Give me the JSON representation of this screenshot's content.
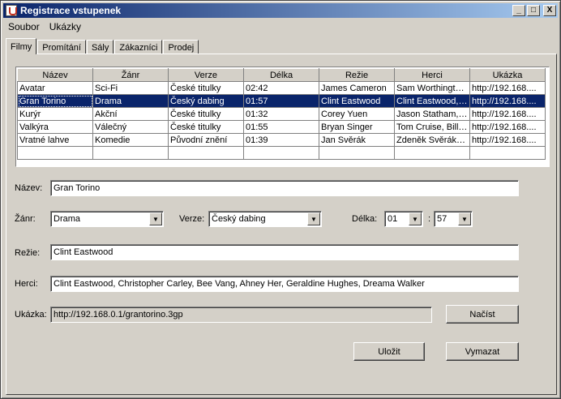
{
  "window": {
    "title": "Registrace vstupenek",
    "minimize": "_",
    "maximize": "□",
    "close": "X"
  },
  "menu": [
    "Soubor",
    "Ukázky"
  ],
  "tabs": [
    "Filmy",
    "Promítání",
    "Sály",
    "Zákazníci",
    "Prodej"
  ],
  "table": {
    "columns": [
      "Název",
      "Žánr",
      "Verze",
      "Délka",
      "Režie",
      "Herci",
      "Ukázka"
    ],
    "rows": [
      [
        "Avatar",
        "Sci-Fi",
        "České titulky",
        "02:42",
        "James Cameron",
        "Sam Worthington...",
        "http://192.168...."
      ],
      [
        "Gran Torino",
        "Drama",
        "Český dabing",
        "01:57",
        "Clint Eastwood",
        "Clint Eastwood, ...",
        "http://192.168...."
      ],
      [
        "Kurýr",
        "Akční",
        "České titulky",
        "01:32",
        "Corey Yuen",
        "Jason Statham, ...",
        "http://192.168...."
      ],
      [
        "Valkýra",
        "Válečný",
        "České titulky",
        "01:55",
        "Bryan Singer",
        "Tom Cruise, Bill ...",
        "http://192.168...."
      ],
      [
        "Vratné lahve",
        "Komedie",
        "Původní znění",
        "01:39",
        "Jan Svěrák",
        "Zdeněk Svěrák, ...",
        "http://192.168...."
      ]
    ],
    "selected_row": 1
  },
  "form": {
    "name_label": "Název:",
    "name_value": "Gran Torino",
    "genre_label": "Žánr:",
    "genre_value": "Drama",
    "version_label": "Verze:",
    "version_value": "Český dabing",
    "length_label": "Délka:",
    "length_hours": "01",
    "length_sep": ":",
    "length_minutes": "57",
    "director_label": "Režie:",
    "director_value": "Clint Eastwood",
    "actors_label": "Herci:",
    "actors_value": "Clint Eastwood, Christopher Carley, Bee Vang, Ahney Her, Geraldine Hughes, Dreama Walker",
    "trailer_label": "Ukázka:",
    "trailer_value": "http://192.168.0.1/grantorino.3gp",
    "load_button": "Načíst",
    "save_button": "Uložit",
    "clear_button": "Vymazat"
  }
}
